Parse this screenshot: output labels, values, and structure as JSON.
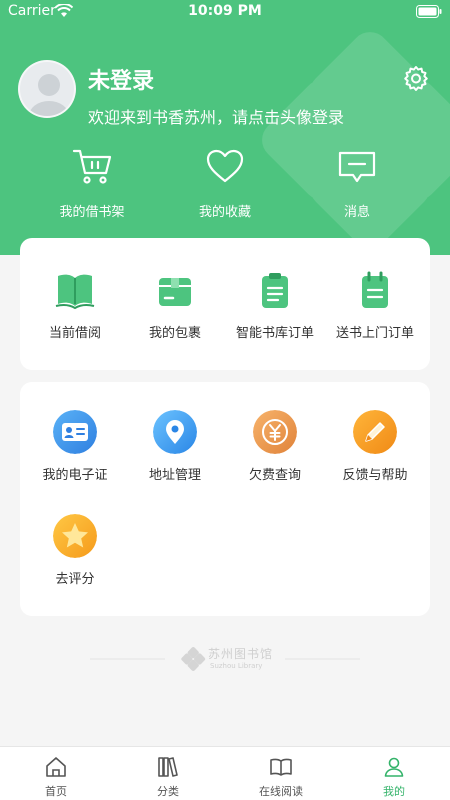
{
  "status_bar": {
    "carrier": "Carrier",
    "time": "10:09 PM"
  },
  "profile": {
    "name": "未登录",
    "welcome": "欢迎来到书香苏州，请点击头像登录"
  },
  "quick_actions": [
    {
      "label": "我的借书架",
      "icon": "cart-icon"
    },
    {
      "label": "我的收藏",
      "icon": "heart-icon"
    },
    {
      "label": "消息",
      "icon": "message-icon"
    }
  ],
  "orders": [
    {
      "label": "当前借阅",
      "icon": "book-open-icon"
    },
    {
      "label": "我的包裹",
      "icon": "package-icon"
    },
    {
      "label": "智能书库订单",
      "icon": "clipboard-icon"
    },
    {
      "label": "送书上门订单",
      "icon": "notepad-icon"
    }
  ],
  "services": [
    {
      "label": "我的电子证",
      "icon": "id-card-icon"
    },
    {
      "label": "地址管理",
      "icon": "location-pin-icon"
    },
    {
      "label": "欠费查询",
      "icon": "yuan-coin-icon"
    },
    {
      "label": "反馈与帮助",
      "icon": "pencil-icon"
    },
    {
      "label": "去评分",
      "icon": "star-icon"
    }
  ],
  "footer": {
    "logo_text": "苏州图书馆",
    "logo_subtext": "Suzhou Library"
  },
  "tabs": [
    {
      "label": "首页",
      "icon": "home-icon"
    },
    {
      "label": "分类",
      "icon": "books-icon"
    },
    {
      "label": "在线阅读",
      "icon": "reading-icon"
    },
    {
      "label": "我的",
      "icon": "user-icon"
    }
  ],
  "colors": {
    "brand_green": "#4dc47f",
    "active_tab": "#34b36a"
  }
}
